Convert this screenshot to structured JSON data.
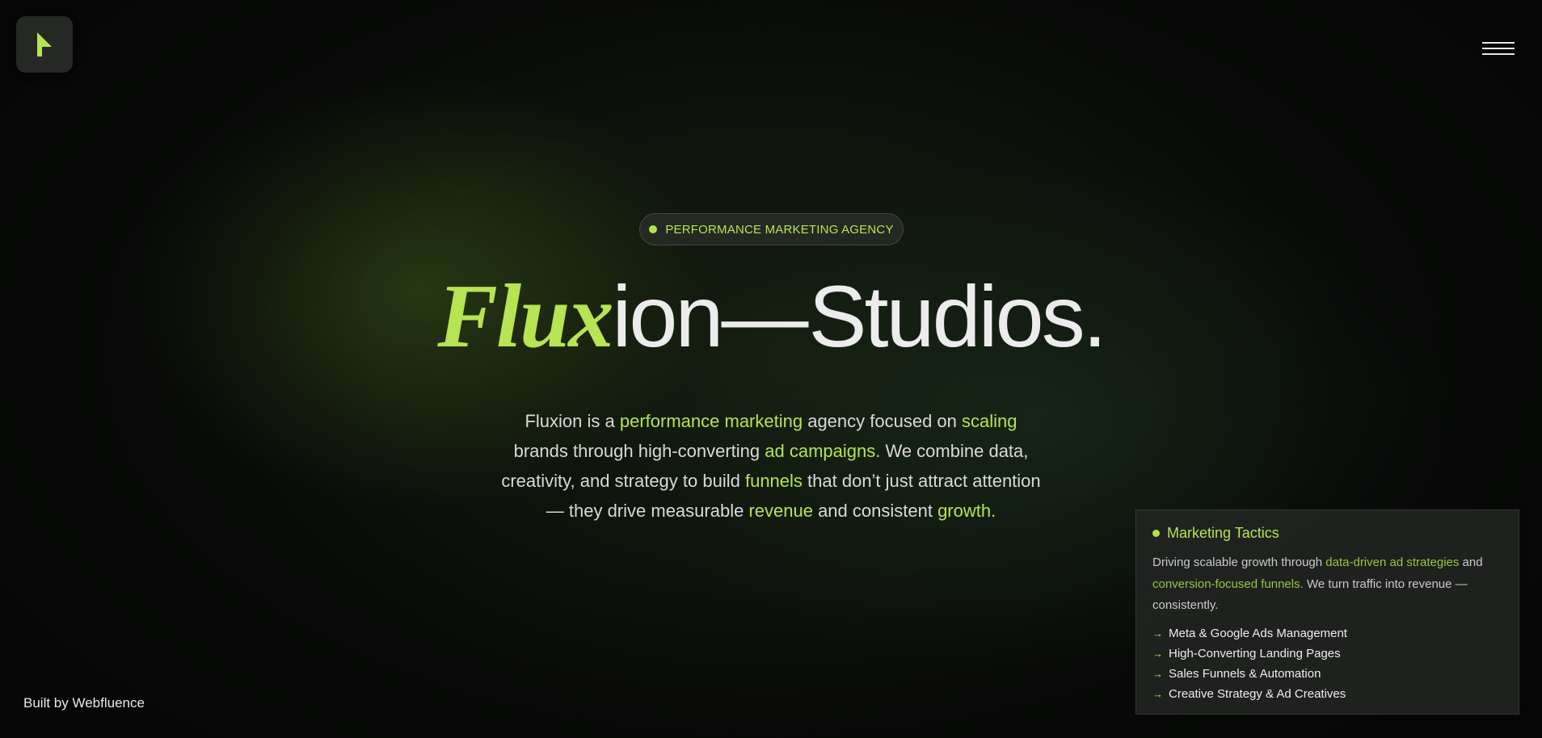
{
  "header": {
    "logo_icon": "cursor-arrow-icon",
    "menu_icon": "hamburger-menu-icon"
  },
  "badge": {
    "text": "PERFORMANCE MARKETING AGENCY"
  },
  "headline": {
    "accent": "Flux",
    "rest": "ion",
    "dash": "—",
    "studio": "Studios."
  },
  "description": {
    "p1": "Fluxion is a ",
    "h1": "performance marketing",
    "p2": " agency focused on ",
    "h2": "scaling",
    "p3": " brands through high-converting ",
    "h3": "ad campaigns.",
    "p4": " We combine data, creativity, and strategy to build ",
    "h4": "funnels",
    "p5": " that don’t just attract attention — they drive measurable ",
    "h5": "revenue",
    "p6": " and consistent ",
    "h6": "growth."
  },
  "credit": {
    "text": "Built by Webfluence"
  },
  "card": {
    "title": "Marketing Tactics",
    "body_p1": "Driving scalable growth through ",
    "body_h1": "data-driven ad strategies",
    "body_p2": " and ",
    "body_h2": "conversion-focused funnels.",
    "body_p3": " We turn traffic into revenue — consistently.",
    "arrow": "→",
    "items": [
      "Meta & Google Ads Management",
      "High-Converting Landing Pages",
      "Sales Funnels & Automation",
      "Creative Strategy & Ad Creatives"
    ]
  },
  "colors": {
    "accent": "#b6e452",
    "background": "#0a0c0a",
    "text": "#ececec"
  }
}
